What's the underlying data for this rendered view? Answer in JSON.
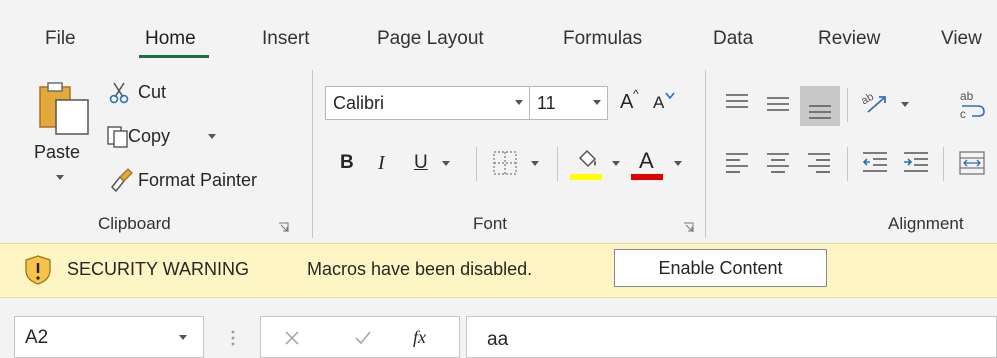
{
  "tabs": [
    {
      "label": "File"
    },
    {
      "label": "Home"
    },
    {
      "label": "Insert"
    },
    {
      "label": "Page Layout"
    },
    {
      "label": "Formulas"
    },
    {
      "label": "Data"
    },
    {
      "label": "Review"
    },
    {
      "label": "View"
    }
  ],
  "active_tab": "Home",
  "clipboard": {
    "paste": "Paste",
    "cut": "Cut",
    "copy": "Copy",
    "format_painter": "Format Painter",
    "label": "Clipboard"
  },
  "font": {
    "name": "Calibri",
    "size": "11",
    "grow_icon": "font-size-increase-icon",
    "shrink_icon": "font-size-decrease-icon",
    "bold": "B",
    "italic": "I",
    "underline": "U",
    "font_color_letter": "A",
    "highlight_color": "#ffff00",
    "font_color": "#e00000",
    "label": "Font"
  },
  "alignment": {
    "label": "Alignment"
  },
  "security": {
    "title": "SECURITY WARNING",
    "message": "Macros have been disabled.",
    "button": "Enable Content"
  },
  "formula_bar": {
    "name_box": "A2",
    "fx": "fx",
    "value": "aa"
  },
  "colors": {
    "accent": "#1e6e42",
    "warning_bg": "#fdf6c4"
  }
}
